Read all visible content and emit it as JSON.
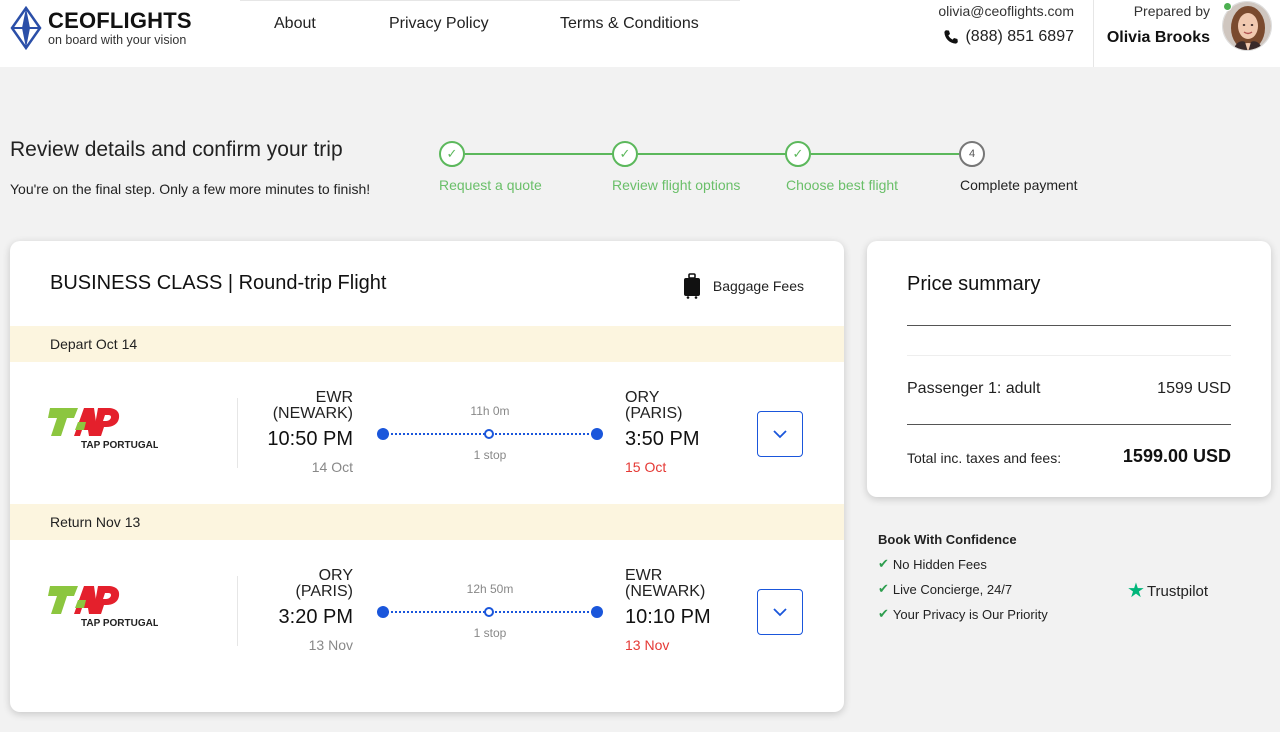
{
  "header": {
    "brand": "CEOFLIGHTS",
    "tagline": "on board with your vision",
    "nav": [
      "About",
      "Privacy Policy",
      "Terms & Conditions"
    ],
    "email": "olivia@ceoflights.com",
    "phone": "(888) 851 6897",
    "prepared_label": "Prepared by",
    "prepared_name": "Olivia Brooks"
  },
  "page": {
    "title": "Review details and confirm your trip",
    "subtitle": "You're on the final step. Only a few more minutes to finish!"
  },
  "stepper": {
    "steps": [
      {
        "label": "Request a quote",
        "status": "done"
      },
      {
        "label": "Review flight options",
        "status": "done"
      },
      {
        "label": "Choose best flight",
        "status": "done"
      },
      {
        "label": "Complete payment",
        "status": "current",
        "number": "4"
      }
    ]
  },
  "flight": {
    "title": "BUSINESS CLASS | Round-trip Flight",
    "baggage_label": "Baggage Fees",
    "outbound": {
      "band": "Depart Oct 14",
      "airline": "TAP PORTUGAL",
      "dep_code": "EWR",
      "dep_city": "(NEWARK)",
      "dep_time": "10:50 PM",
      "dep_date": "14 Oct",
      "duration": "11h 0m",
      "stops": "1 stop",
      "arr_code": "ORY",
      "arr_city": "(PARIS)",
      "arr_time": "3:50 PM",
      "arr_date": "15 Oct"
    },
    "return": {
      "band": "Return Nov 13",
      "airline": "TAP PORTUGAL",
      "dep_code": "ORY",
      "dep_city": "(PARIS)",
      "dep_time": "3:20 PM",
      "dep_date": "13 Nov",
      "duration": "12h 50m",
      "stops": "1 stop",
      "arr_code": "EWR",
      "arr_city": "(NEWARK)",
      "arr_time": "10:10 PM",
      "arr_date": "13 Nov"
    }
  },
  "price": {
    "title": "Price summary",
    "passenger_label": "Passenger 1: adult",
    "passenger_value": "1599 USD",
    "total_label": "Total inc. taxes and fees:",
    "total_value": "1599.00 USD"
  },
  "confidence": {
    "title": "Book With Confidence",
    "items": [
      "No Hidden Fees",
      "Live Concierge, 24/7",
      "Your Privacy is Our Priority"
    ],
    "trustpilot": "Trustpilot"
  },
  "colors": {
    "accent_blue": "#1a56db",
    "step_green": "#5cb85c",
    "band_cream": "#fcf5df",
    "arrival_red": "#e53935",
    "tap_green": "#8cc63f",
    "tap_red": "#e4202c"
  }
}
